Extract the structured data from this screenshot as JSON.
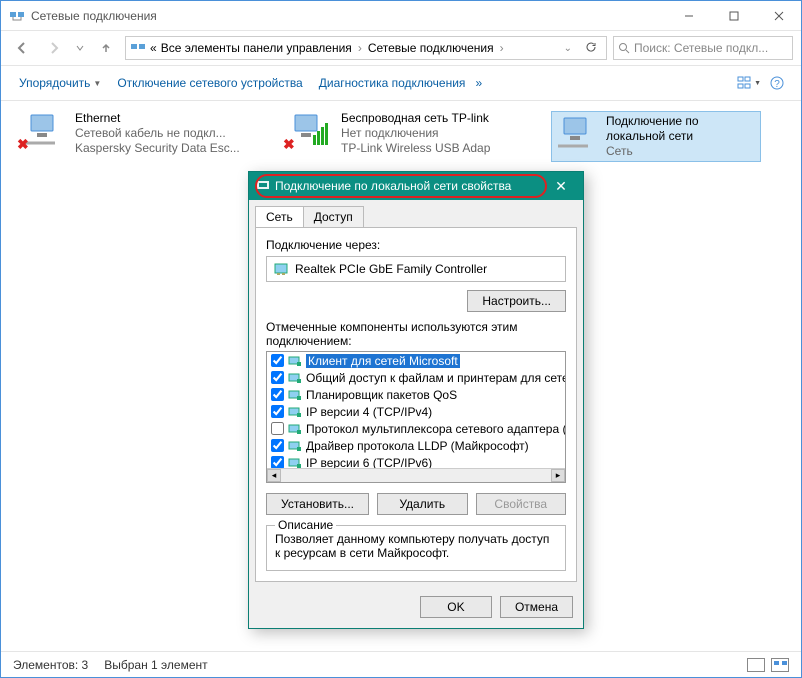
{
  "window": {
    "title": "Сетевые подключения"
  },
  "address": {
    "seg1": "«",
    "seg2": "Все элементы панели управления",
    "seg3": "Сетевые подключения"
  },
  "search": {
    "placeholder": "Поиск: Сетевые подкл..."
  },
  "toolbar": {
    "organize": "Упорядочить",
    "disable": "Отключение сетевого устройства",
    "diagnose": "Диагностика подключения"
  },
  "connections": [
    {
      "title": "Ethernet",
      "sub1": "Сетевой кабель не подкл...",
      "sub2": "Kaspersky Security Data Esc..."
    },
    {
      "title": "Беспроводная сеть TP-link",
      "sub1": "Нет подключения",
      "sub2": "TP-Link Wireless USB Adap"
    },
    {
      "title": "Подключение по локальной сети",
      "sub1": "Сеть",
      "sub2": ""
    }
  ],
  "status": {
    "count": "Элементов: 3",
    "selected": "Выбран 1 элемент"
  },
  "dialog": {
    "title": "Подключение по локальной сети свойства",
    "tab_network": "Сеть",
    "tab_access": "Доступ",
    "connect_via_label": "Подключение через:",
    "adapter": "Realtek PCIe GbE Family Controller",
    "configure": "Настроить...",
    "components_label": "Отмеченные компоненты используются этим подключением:",
    "components": [
      {
        "checked": true,
        "label": "Клиент для сетей Microsoft",
        "selected": true
      },
      {
        "checked": true,
        "label": "Общий доступ к файлам и принтерам для сетей Mi"
      },
      {
        "checked": true,
        "label": "Планировщик пакетов QoS"
      },
      {
        "checked": true,
        "label": "IP версии 4 (TCP/IPv4)"
      },
      {
        "checked": false,
        "label": "Протокол мультиплексора сетевого адаптера (Ма"
      },
      {
        "checked": true,
        "label": "Драйвер протокола LLDP (Майкрософт)"
      },
      {
        "checked": true,
        "label": "IP версии 6 (TCP/IPv6)"
      }
    ],
    "install": "Установить...",
    "remove": "Удалить",
    "properties": "Свойства",
    "desc_legend": "Описание",
    "desc_text": "Позволяет данному компьютеру получать доступ к ресурсам в сети Майкрософт.",
    "ok": "OK",
    "cancel": "Отмена"
  }
}
